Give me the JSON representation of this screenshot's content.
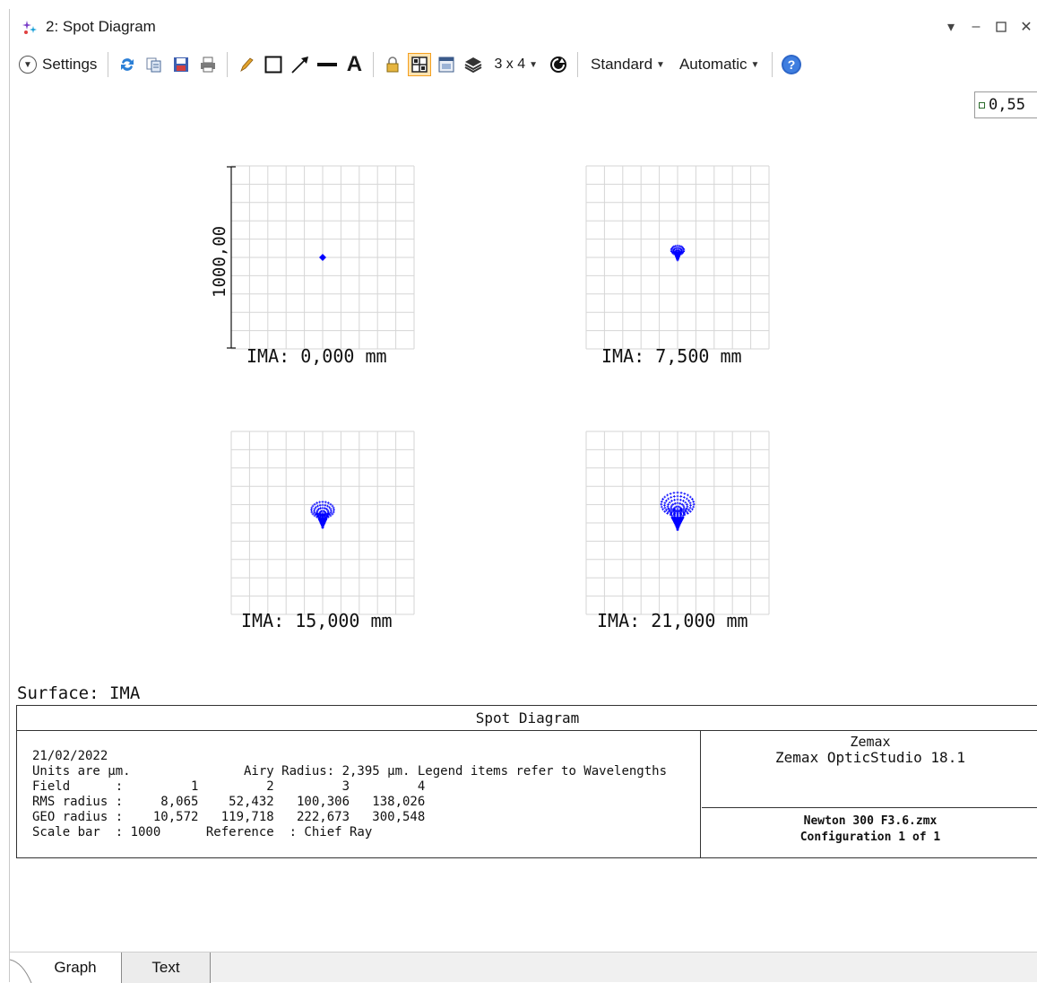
{
  "window": {
    "title": "2: Spot Diagram",
    "controls": [
      "dropdown-arrow",
      "minimize",
      "maximize",
      "close"
    ]
  },
  "toolbar": {
    "settings_label": "Settings",
    "layout_label": "3 x 4",
    "standard_label": "Standard",
    "automatic_label": "Automatic",
    "icons": [
      "refresh-icon",
      "copy-icon",
      "save-icon",
      "print-icon",
      "pencil-icon",
      "rectangle-icon",
      "arrow-icon",
      "line-icon",
      "text-icon",
      "lock-icon",
      "grid-view-icon",
      "window-icon",
      "layers-icon",
      "reset-icon",
      "help-icon"
    ],
    "accent": "#f4a020"
  },
  "readout": {
    "value": "0,55"
  },
  "plots": [
    {
      "label": "IMA: 0,000 mm",
      "spot": "point"
    },
    {
      "label": "IMA: 7,500 mm",
      "spot": "small-comet"
    },
    {
      "label": "IMA: 15,000 mm",
      "spot": "medium-comet"
    },
    {
      "label": "IMA: 21,000 mm",
      "spot": "large-comet"
    }
  ],
  "scale_bar_label": "1000,00",
  "spot_color": "#0000ff",
  "grid_color": "#d6d6d6",
  "surface_label": "Surface: IMA",
  "info": {
    "title": "Spot Diagram",
    "body": "21/02/2022\nUnits are µm.               Airy Radius: 2,395 µm. Legend items refer to Wavelengths\nField      :         1         2         3         4\nRMS radius :     8,065    52,432   100,306   138,026\nGEO radius :    10,572   119,718   222,673   300,548\nScale bar  : 1000      Reference  : Chief Ray",
    "company": "Zemax",
    "product": "Zemax OpticStudio 18.1",
    "file": "Newton 300 F3.6.zmx",
    "configuration": "Configuration 1 of 1"
  },
  "tabs": [
    {
      "label": "Graph",
      "active": true
    },
    {
      "label": "Text",
      "active": false
    }
  ]
}
